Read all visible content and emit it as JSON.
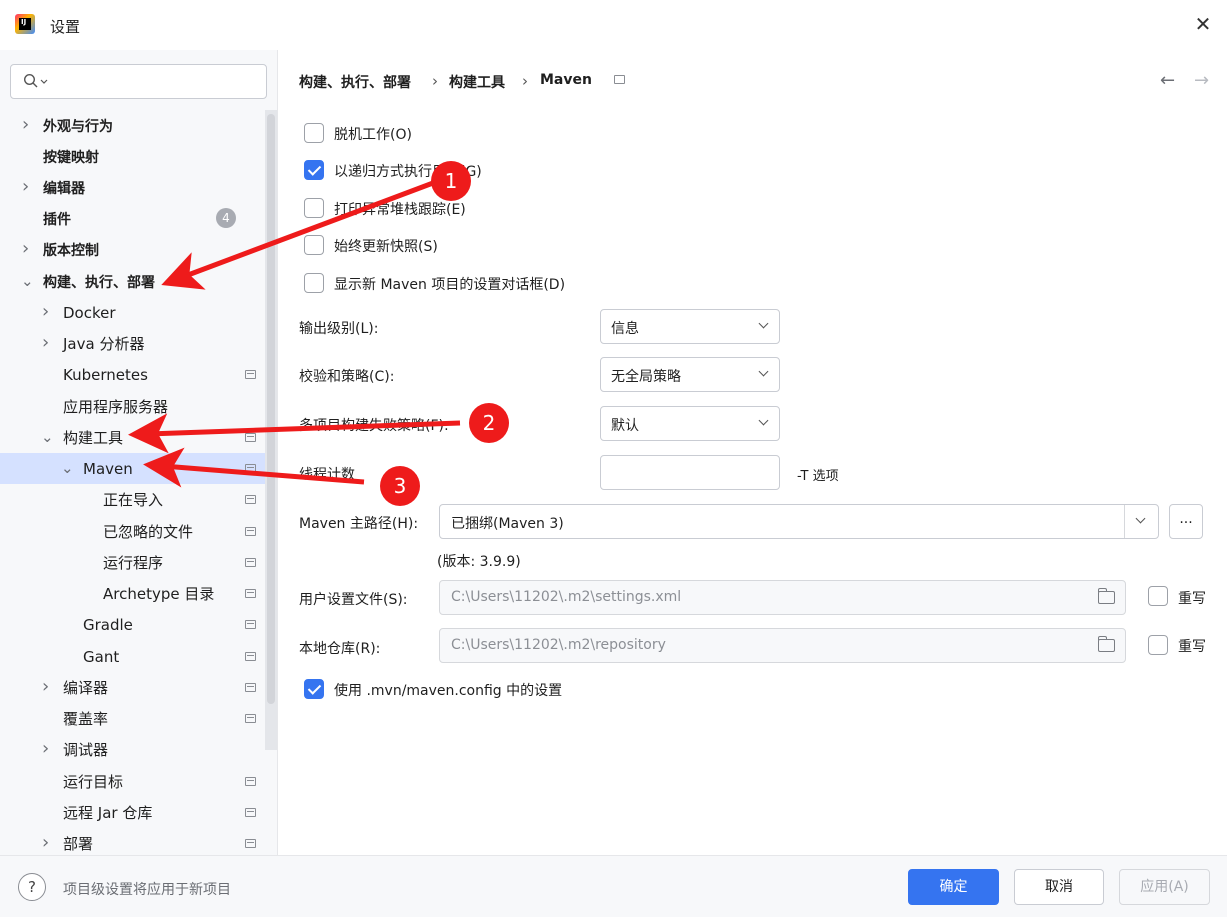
{
  "window": {
    "title": "设置",
    "logo_text": "IJ"
  },
  "search": {
    "placeholder": ""
  },
  "sidebar": {
    "items": [
      {
        "label": "外观与行为",
        "bold": true,
        "chevron": "right"
      },
      {
        "label": "按键映射",
        "bold": true,
        "chevron": "none"
      },
      {
        "label": "编辑器",
        "bold": true,
        "chevron": "right"
      },
      {
        "label": "插件",
        "bold": true,
        "chevron": "none",
        "badge": "4"
      },
      {
        "label": "版本控制",
        "bold": true,
        "chevron": "right"
      },
      {
        "label": "构建、执行、部署",
        "bold": true,
        "chevron": "down"
      },
      {
        "label": "Docker",
        "chevron": "right"
      },
      {
        "label": "Java 分析器",
        "chevron": "right"
      },
      {
        "label": "Kubernetes",
        "chevron": "none"
      },
      {
        "label": "应用程序服务器",
        "chevron": "none"
      },
      {
        "label": "构建工具",
        "chevron": "down"
      },
      {
        "label": "Maven",
        "chevron": "down",
        "selected": true
      },
      {
        "label": "正在导入",
        "chevron": "none"
      },
      {
        "label": "已忽略的文件",
        "chevron": "none"
      },
      {
        "label": "运行程序",
        "chevron": "none"
      },
      {
        "label": "Archetype 目录",
        "chevron": "none"
      },
      {
        "label": "Gradle",
        "chevron": "none"
      },
      {
        "label": "Gant",
        "chevron": "none"
      },
      {
        "label": "编译器",
        "chevron": "right"
      },
      {
        "label": "覆盖率",
        "chevron": "none"
      },
      {
        "label": "调试器",
        "chevron": "right"
      },
      {
        "label": "运行目标",
        "chevron": "none"
      },
      {
        "label": "远程 Jar 仓库",
        "chevron": "none"
      },
      {
        "label": "部署",
        "chevron": "right"
      }
    ]
  },
  "breadcrumb": {
    "part1": "构建、执行、部署",
    "part2": "构建工具",
    "part3": "Maven",
    "sep": "›"
  },
  "nav": {
    "back": "←",
    "forward": "→"
  },
  "options": {
    "offline": {
      "label": "脱机工作(O)",
      "checked": false
    },
    "recursive": {
      "label": "以递归方式执行目标(G)",
      "checked": true
    },
    "stacktrace": {
      "label": "打印异常堆栈跟踪(E)",
      "checked": false
    },
    "snapshots": {
      "label": "始终更新快照(S)",
      "checked": false
    },
    "show_dialog": {
      "label": "显示新 Maven 项目的设置对话框(D)",
      "checked": false
    }
  },
  "fields": {
    "output_level": {
      "label": "输出级别(L):",
      "value": "信息"
    },
    "checksum": {
      "label": "校验和策略(C):",
      "value": "无全局策略"
    },
    "multiproject": {
      "label": "多项目构建失败策略(F):",
      "value": "默认"
    },
    "threads": {
      "label": "线程计数",
      "value": "",
      "suffix": "-T 选项"
    },
    "maven_home": {
      "label": "Maven 主路径(H):",
      "value": "已捆绑(Maven 3)",
      "browse": "...",
      "version": "(版本: 3.9.9)"
    },
    "user_settings": {
      "label": "用户设置文件(S):",
      "value": "C:\\Users\\11202\\.m2\\settings.xml",
      "override": "重写"
    },
    "local_repo": {
      "label": "本地仓库(R):",
      "value": "C:\\Users\\11202\\.m2\\repository",
      "override": "重写"
    },
    "use_mvn_config": {
      "label": "使用 .mvn/maven.config 中的设置",
      "checked": true
    }
  },
  "footer": {
    "help": "?",
    "hint": "项目级设置将应用于新项目",
    "ok": "确定",
    "cancel": "取消",
    "apply": "应用(A)"
  },
  "annotations": {
    "n1": "1",
    "n2": "2",
    "n3": "3",
    "arrow_color": "#ee1b1b"
  },
  "colors": {
    "accent": "#3574f0",
    "selected_row": "#d5e1ff",
    "annotation": "#ee1b1b"
  }
}
